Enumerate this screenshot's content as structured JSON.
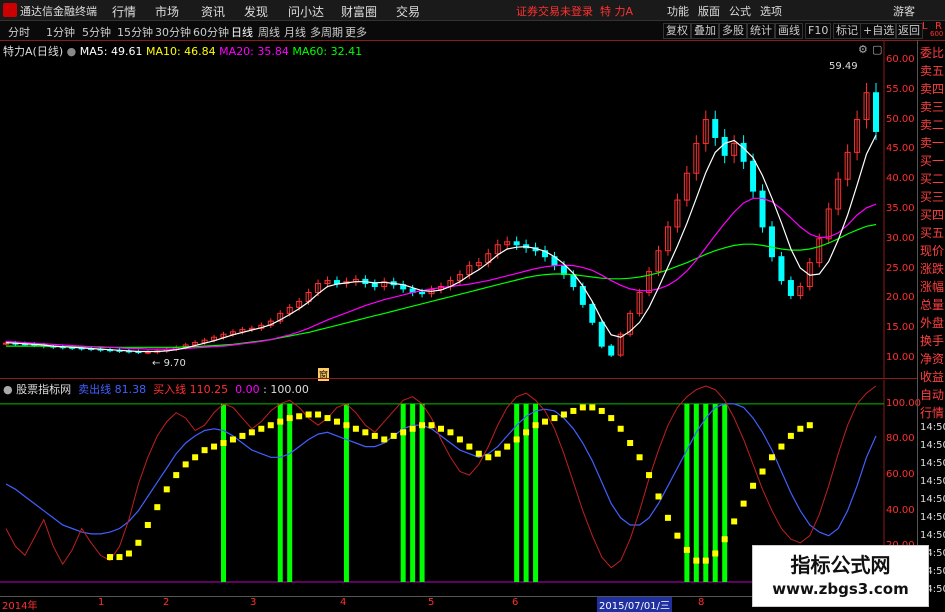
{
  "app": {
    "title": "通达信金融终端"
  },
  "menu": [
    "行情",
    "市场",
    "资讯",
    "发现",
    "问小达",
    "财富圈",
    "交易"
  ],
  "status": {
    "text": "证券交易未登录"
  },
  "stock": {
    "name": "特 力A",
    "name_chart": "特力A",
    "period": "(日线)"
  },
  "right_menu": [
    "功能",
    "版面",
    "公式",
    "选项",
    "游客"
  ],
  "periods": [
    "分时",
    "1分钟",
    "5分钟",
    "15分钟",
    "30分钟",
    "60分钟",
    "日线",
    "周线",
    "月线",
    "多周期",
    "更多"
  ],
  "active_period": "日线",
  "toolbar": [
    "复权",
    "叠加",
    "多股",
    "统计",
    "画线",
    "F10",
    "标记",
    "+自选",
    "返回"
  ],
  "right_tags": {
    "L": "L",
    "R": "R",
    "value": "600"
  },
  "ma": [
    {
      "label": "MA5: 49.61",
      "color": "#ffffff"
    },
    {
      "label": "MA10: 46.84",
      "color": "#ffff00"
    },
    {
      "label": "MA20: 35.84",
      "color": "#ff00ff"
    },
    {
      "label": "MA60: 32.41",
      "color": "#00ff00"
    }
  ],
  "price_axis": [
    "60.00",
    "55.00",
    "50.00",
    "45.00",
    "40.00",
    "35.00",
    "30.00",
    "25.00",
    "20.00",
    "15.00",
    "10.00"
  ],
  "annotations": {
    "high": "59.49",
    "low": "9.70",
    "marker": "窗"
  },
  "indicator": {
    "name": "股票指标网",
    "sell_label": "卖出线",
    "sell_value": "81.38",
    "buy_label": "买入线",
    "buy_value": "110.25",
    "v3": "0.00",
    "v4": "100.00",
    "axis": [
      "100.00",
      "80.00",
      "60.00",
      "40.00",
      "20.00"
    ]
  },
  "side_panel": [
    "委比",
    "卖五",
    "卖四",
    "卖三",
    "卖二",
    "卖一",
    "买一",
    "买二",
    "买三",
    "买四",
    "买五",
    "现价",
    "涨跌",
    "涨幅",
    "总量",
    "外盘",
    "换手",
    "净资",
    "收益",
    "自动",
    "行情",
    "14:50",
    "14:50",
    "14:50",
    "14:50",
    "14:50",
    "14:50",
    "14:50",
    "14:50",
    "14:50",
    "14:50"
  ],
  "x_axis": [
    "2014年",
    "1",
    "2",
    "3",
    "4",
    "5",
    "6",
    "8"
  ],
  "x_date": "2015/07/01/三",
  "watermark": {
    "line1": "指标公式网",
    "line2": "www.zbgs3.com"
  },
  "colors": {
    "up": "#ff3030",
    "down": "#00ffff",
    "ma5": "#ffffff",
    "ma10": "#ffff00",
    "ma20": "#ff00ff",
    "ma60": "#00ff00",
    "sell": "#4060ff",
    "buy": "#ff3030",
    "signal": "#ffff00",
    "bar": "#00ff00"
  },
  "chart_data": [
    {
      "type": "candlestick",
      "ylim": [
        8,
        62
      ],
      "close": [
        12.5,
        12.4,
        12.3,
        12.2,
        12.0,
        11.9,
        11.8,
        11.7,
        11.6,
        11.5,
        11.4,
        11.3,
        11.2,
        11.1,
        11.0,
        11.0,
        11.2,
        11.5,
        11.8,
        12.2,
        12.6,
        13.0,
        13.5,
        14.0,
        14.4,
        14.8,
        15.0,
        15.5,
        16.2,
        17.5,
        18.5,
        19.5,
        21.0,
        22.5,
        23.0,
        22.5,
        22.8,
        23.2,
        22.5,
        22.0,
        22.8,
        22.3,
        21.6,
        21.0,
        20.8,
        21.5,
        22.0,
        23.0,
        24.0,
        25.5,
        26.0,
        27.5,
        29.0,
        29.5,
        29.0,
        28.5,
        28.0,
        27.0,
        25.5,
        24.0,
        22.0,
        19.0,
        16.0,
        12.0,
        10.5,
        14.0,
        17.5,
        21.0,
        24.5,
        28.0,
        32.0,
        36.5,
        41.0,
        46.0,
        50.0,
        47.0,
        44.0,
        46.0,
        43.0,
        38.0,
        32.0,
        27.0,
        23.0,
        20.5,
        22.0,
        26.0,
        30.0,
        35.0,
        40.0,
        44.5,
        50.0,
        54.5,
        48.0
      ],
      "ma5": [
        12.6,
        12.5,
        12.4,
        12.3,
        12.2,
        12.0,
        11.9,
        11.8,
        11.7,
        11.6,
        11.5,
        11.4,
        11.3,
        11.2,
        11.1,
        11.1,
        11.1,
        11.2,
        11.4,
        11.7,
        12.1,
        12.5,
        12.9,
        13.4,
        13.9,
        14.3,
        14.7,
        15.1,
        15.6,
        16.4,
        17.3,
        18.3,
        19.4,
        20.8,
        22.0,
        22.4,
        22.6,
        22.8,
        22.8,
        22.6,
        22.7,
        22.5,
        22.3,
        21.8,
        21.3,
        21.2,
        21.4,
        22.0,
        22.8,
        23.9,
        24.8,
        26.0,
        27.3,
        28.3,
        28.6,
        28.7,
        28.4,
        27.9,
        27.0,
        25.8,
        24.2,
        22.1,
        19.5,
        16.4,
        13.9,
        13.5,
        14.5,
        16.0,
        18.5,
        21.8,
        25.3,
        28.8,
        32.6,
        36.8,
        41.1,
        44.5,
        46.0,
        46.5,
        45.2,
        43.6,
        40.6,
        36.8,
        32.7,
        28.3,
        25.1,
        23.9,
        24.1,
        26.2,
        29.8,
        34.0,
        39.0,
        44.2,
        47.4
      ],
      "ma20": [
        12.8,
        12.7,
        12.6,
        12.5,
        12.4,
        12.3,
        12.2,
        12.1,
        12.0,
        11.9,
        11.9,
        11.8,
        11.7,
        11.6,
        11.6,
        11.5,
        11.5,
        11.5,
        11.5,
        11.6,
        11.7,
        11.8,
        11.9,
        12.0,
        12.2,
        12.4,
        12.6,
        12.8,
        13.1,
        13.5,
        13.9,
        14.4,
        15.0,
        15.7,
        16.4,
        17.0,
        17.6,
        18.2,
        18.8,
        19.3,
        19.8,
        20.2,
        20.6,
        21.0,
        21.3,
        21.6,
        21.8,
        22.0,
        22.2,
        22.4,
        22.7,
        23.0,
        23.4,
        23.8,
        24.2,
        24.6,
        25.0,
        25.3,
        25.5,
        25.6,
        25.5,
        25.2,
        24.7,
        23.9,
        23.0,
        22.2,
        21.6,
        21.3,
        21.3,
        21.6,
        22.2,
        23.2,
        24.6,
        26.4,
        28.5,
        30.6,
        32.6,
        34.5,
        36.0,
        36.8,
        36.8,
        36.2,
        35.0,
        33.5,
        32.0,
        30.8,
        30.2,
        30.3,
        31.0,
        32.3,
        34.0,
        35.2,
        35.8
      ],
      "ma60": [
        12.0,
        12.0,
        12.0,
        12.0,
        12.0,
        11.9,
        11.9,
        11.9,
        11.9,
        11.9,
        11.8,
        11.8,
        11.8,
        11.8,
        11.8,
        11.8,
        11.8,
        11.8,
        11.8,
        11.9,
        11.9,
        12.0,
        12.1,
        12.2,
        12.3,
        12.5,
        12.7,
        12.9,
        13.1,
        13.4,
        13.7,
        14.0,
        14.3,
        14.7,
        15.1,
        15.5,
        15.9,
        16.3,
        16.7,
        17.1,
        17.5,
        17.9,
        18.3,
        18.7,
        19.1,
        19.5,
        19.9,
        20.3,
        20.7,
        21.1,
        21.5,
        21.9,
        22.3,
        22.7,
        23.1,
        23.5,
        23.8,
        24.0,
        24.1,
        24.1,
        24.0,
        23.8,
        23.6,
        23.4,
        23.3,
        23.3,
        23.4,
        23.6,
        23.9,
        24.3,
        24.8,
        25.4,
        26.0,
        26.7,
        27.4,
        28.0,
        28.5,
        28.9,
        29.1,
        29.1,
        28.9,
        28.6,
        28.3,
        28.1,
        28.1,
        28.3,
        28.7,
        29.3,
        30.0,
        30.8,
        31.5,
        32.1,
        32.4
      ]
    },
    {
      "type": "line",
      "ylim": [
        0,
        110
      ],
      "sell": [
        55,
        52,
        48,
        44,
        40,
        36,
        32,
        30,
        28,
        27,
        27,
        28,
        30,
        34,
        40,
        48,
        56,
        64,
        72,
        78,
        82,
        85,
        86,
        85,
        82,
        78,
        74,
        72,
        70,
        70,
        72,
        76,
        80,
        83,
        84,
        82,
        80,
        78,
        76,
        76,
        78,
        82,
        86,
        88,
        88,
        86,
        82,
        78,
        74,
        72,
        70,
        72,
        76,
        82,
        88,
        93,
        96,
        97,
        96,
        92,
        86,
        78,
        68,
        56,
        44,
        36,
        32,
        32,
        36,
        44,
        54,
        64,
        74,
        84,
        92,
        98,
        100,
        100,
        98,
        92,
        84,
        74,
        62,
        50,
        40,
        32,
        28,
        26,
        30,
        40,
        54,
        70,
        82
      ],
      "buy": [
        30,
        20,
        15,
        25,
        35,
        20,
        10,
        18,
        30,
        22,
        15,
        12,
        20,
        35,
        55,
        70,
        82,
        90,
        95,
        92,
        85,
        88,
        95,
        100,
        98,
        92,
        86,
        90,
        96,
        100,
        102,
        98,
        92,
        88,
        92,
        98,
        100,
        95,
        88,
        84,
        90,
        96,
        102,
        104,
        100,
        92,
        80,
        70,
        62,
        60,
        66,
        76,
        88,
        98,
        104,
        106,
        102,
        96,
        86,
        72,
        56,
        40,
        26,
        14,
        8,
        12,
        24,
        40,
        58,
        74,
        88,
        98,
        104,
        108,
        110,
        108,
        102,
        92,
        80,
        66,
        52,
        40,
        30,
        24,
        22,
        26,
        38,
        54,
        72,
        88,
        100,
        106,
        110
      ],
      "signal": [
        null,
        null,
        null,
        null,
        null,
        null,
        null,
        null,
        null,
        null,
        null,
        14,
        14,
        16,
        22,
        32,
        42,
        52,
        60,
        66,
        70,
        74,
        76,
        78,
        80,
        82,
        84,
        86,
        88,
        90,
        92,
        93,
        94,
        94,
        92,
        90,
        88,
        86,
        84,
        82,
        80,
        82,
        84,
        86,
        88,
        88,
        86,
        84,
        80,
        76,
        72,
        70,
        72,
        76,
        80,
        84,
        88,
        90,
        92,
        94,
        96,
        98,
        98,
        96,
        92,
        86,
        78,
        70,
        60,
        48,
        36,
        26,
        18,
        12,
        12,
        16,
        24,
        34,
        44,
        54,
        62,
        70,
        76,
        82,
        86,
        88
      ]
    }
  ]
}
